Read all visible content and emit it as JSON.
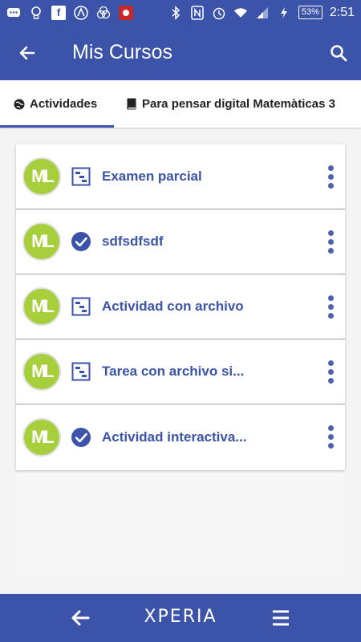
{
  "status_bar": {
    "battery": "53%",
    "time": "2:51"
  },
  "app_bar": {
    "title": "Mis Cursos",
    "back_icon": "arrow-left-icon",
    "search_icon": "search-icon"
  },
  "tabs": [
    {
      "label": "Actividades",
      "icon": "globe-icon",
      "selected": true
    },
    {
      "label": "Para pensar digital Matemàticas 3",
      "icon": "book-icon",
      "selected": false
    }
  ],
  "activities": [
    {
      "avatar_text": "ML",
      "type_icon": "task-icon",
      "title": "Examen parcial"
    },
    {
      "avatar_text": "ML",
      "type_icon": "check-circle-icon",
      "title": "sdfsdfsdf"
    },
    {
      "avatar_text": "ML",
      "type_icon": "task-icon",
      "title": "Actividad con archivo"
    },
    {
      "avatar_text": "ML",
      "type_icon": "task-icon",
      "title": "Tarea con archivo si..."
    },
    {
      "avatar_text": "ML",
      "type_icon": "check-circle-icon",
      "title": "Actividad interactiva..."
    }
  ],
  "nav_bar": {
    "brand": "XPERIA"
  },
  "colors": {
    "primary": "#3b53a8",
    "avatar": "#a6cf3b"
  }
}
